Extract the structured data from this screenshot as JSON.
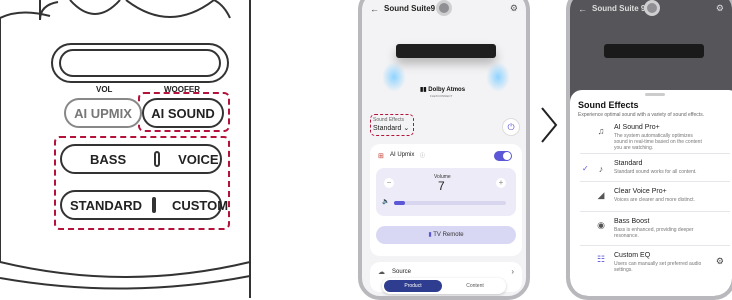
{
  "remote": {
    "vol_label": "VOL",
    "woofer_label": "WOOFER",
    "ai_upmix": "AI UPMIX",
    "ai_sound": "AI SOUND",
    "bass": "BASS",
    "voice": "VOICE",
    "standard": "STANDARD",
    "custom": "CUSTOM"
  },
  "phone1": {
    "title": "Sound Suite9",
    "brand": "Dolby Atmos",
    "brand_sub": "FLEXCONNECT",
    "sound_effects_label": "Sound Effects",
    "sound_effects_value": "Standard",
    "ai_upmix_label": "AI Upmix",
    "volume_label": "Volume",
    "volume_value": "7",
    "volume_level": 0.1,
    "minus": "−",
    "plus": "+",
    "tv_remote": "TV Remote",
    "source_label": "Source",
    "tabs": [
      "Product",
      "Content"
    ]
  },
  "phone2": {
    "title": "Sound Suite 9",
    "sheet_title": "Sound Effects",
    "sheet_subtitle": "Experience optimal sound with a variety of sound effects.",
    "items": [
      {
        "title": "AI Sound Pro+",
        "desc": "The system automatically optimizes sound in real-time based on the content you are watching.",
        "icon": "ai-sound-icon"
      },
      {
        "title": "Standard",
        "desc": "Standard sound works for all content.",
        "icon": "music-note-icon"
      },
      {
        "title": "Clear Voice Pro+",
        "desc": "Voices are clearer and more distinct.",
        "icon": "voice-icon"
      },
      {
        "title": "Bass Boost",
        "desc": "Bass is enhanced, providing deeper resonance.",
        "icon": "bass-icon"
      },
      {
        "title": "Custom EQ",
        "desc": "Users can manually set preferred audio settings.",
        "icon": "eq-icon"
      }
    ]
  }
}
